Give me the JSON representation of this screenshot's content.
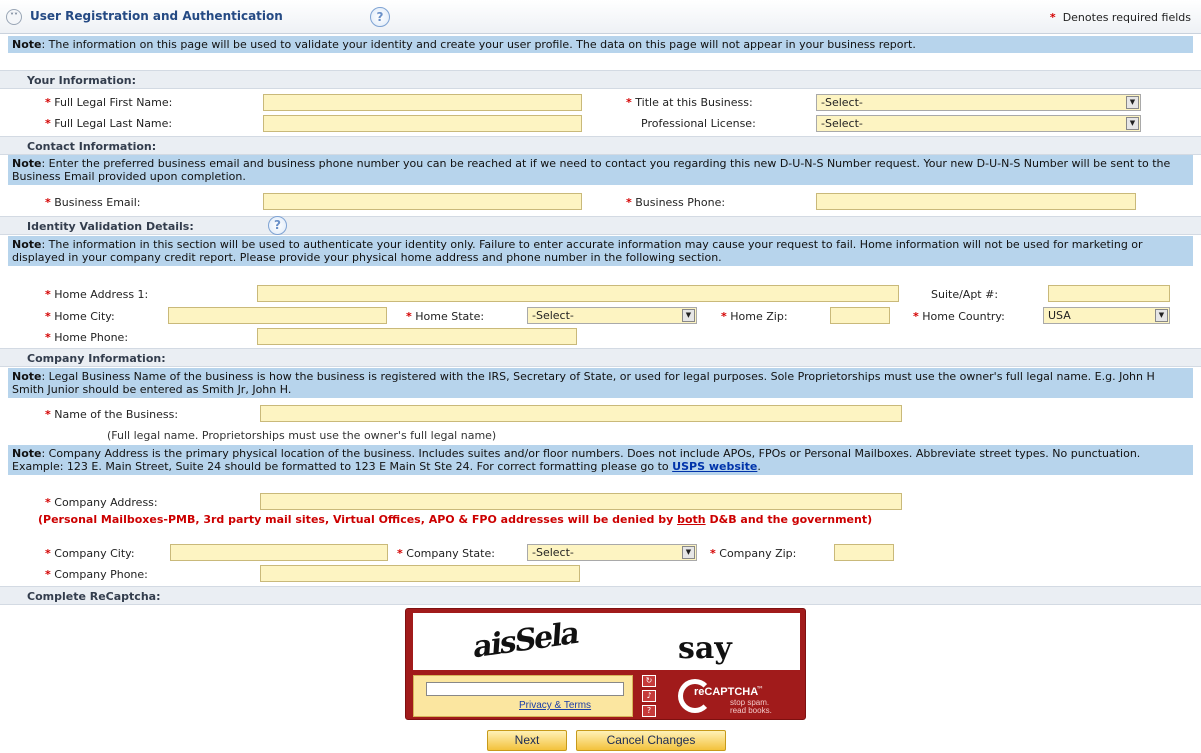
{
  "header": {
    "collapse_icon": "double-chevron-up-icon",
    "title": "User Registration and Authentication",
    "help": "?",
    "required_legend": "Denotes required fields",
    "required_mark": "*"
  },
  "intro_note": {
    "label": "Note",
    "text": ": The information on this page will be used to validate your identity and create your user profile. The data on this page will not appear in your business report."
  },
  "your_info": {
    "heading": "Your Information:",
    "first_name_label": "Full Legal First Name:",
    "last_name_label": "Full Legal Last Name:",
    "title_label": "Title at this Business:",
    "title_value": "-Select-",
    "license_label": "Professional License:",
    "license_value": "-Select-"
  },
  "contact": {
    "heading": "Contact Information:",
    "note_label": "Note",
    "note_text": ": Enter the preferred business email and business phone number you can be reached at if we need to contact you regarding this new D-U-N-S Number request. Your new D-U-N-S Number will be sent to the Business Email provided upon completion.",
    "email_label": "Business Email:",
    "phone_label": "Business Phone:"
  },
  "identity": {
    "heading": "Identity Validation Details:",
    "help": "?",
    "note_label": "Note",
    "note_text": ": The information in this section will be used to authenticate your identity only. Failure to enter accurate information may cause your request to fail. Home information will not be used for marketing or displayed in your company credit report. Please provide your physical home address and phone number in the following section.",
    "address_label": "Home Address 1:",
    "suite_label": "Suite/Apt #:",
    "city_label": "Home City:",
    "state_label": "Home State:",
    "state_value": "-Select-",
    "zip_label": "Home Zip:",
    "country_label": "Home Country:",
    "country_value": "USA",
    "phone_label": "Home Phone:"
  },
  "company": {
    "heading": "Company Information:",
    "note1_label": "Note",
    "note1_text": ": Legal Business Name of the business is how the business is registered with the IRS, Secretary of State, or used for legal purposes. Sole Proprietorships must use the owner's full legal name. E.g. John H Smith Junior should be entered as Smith Jr, John H.",
    "name_label": "Name of the Business:",
    "name_helper": "(Full legal name. Proprietorships must use the owner's full legal name)",
    "note2_label": "Note",
    "note2_text": ": Company Address is the primary physical location of the business. Includes suites and/or floor numbers. Does not include APOs, FPOs or Personal Mailboxes. Abbreviate street types. No punctuation. Example: 123 E. Main Street, Suite 24 should be formatted to 123 E Main St Ste 24. For correct formatting please go to ",
    "note2_link": "USPS website",
    "note2_end": ".",
    "address_label": "Company Address:",
    "warning_pre": "(Personal Mailboxes-PMB, 3rd party mail sites, Virtual Offices, APO & FPO addresses will be denied by ",
    "warning_both": "both",
    "warning_post": " D&B and the government)",
    "city_label": "Company City:",
    "state_label": "Company State:",
    "state_value": "-Select-",
    "zip_label": "Company Zip:",
    "phone_label": "Company Phone:"
  },
  "captcha": {
    "heading": "Complete ReCaptcha:",
    "word1": "aisSela",
    "word2": "say",
    "privacy": "Privacy & Terms",
    "refresh_icon": "refresh-icon",
    "audio_icon": "audio-icon",
    "help_icon": "help-icon",
    "logo_text": "reCAPTCHA",
    "tm": "™",
    "tagline1": "stop spam.",
    "tagline2": "read books."
  },
  "buttons": {
    "next": "Next",
    "cancel": "Cancel Changes"
  }
}
